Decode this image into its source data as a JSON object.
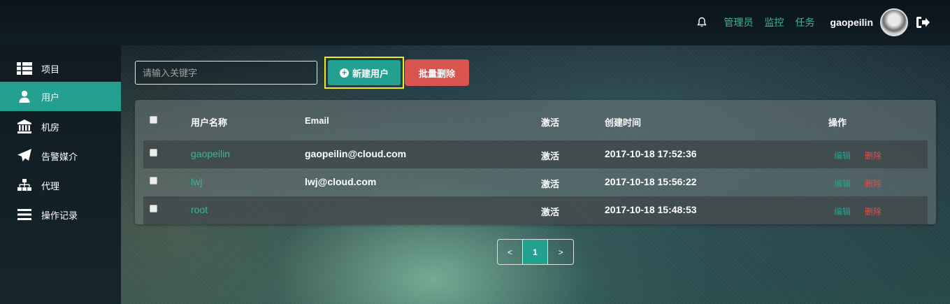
{
  "header": {
    "links": [
      "管理员",
      "监控",
      "任务"
    ],
    "username": "gaopeilin"
  },
  "sidebar": {
    "items": [
      {
        "label": "项目",
        "icon": "list-icon"
      },
      {
        "label": "用户",
        "icon": "user-icon",
        "active": true
      },
      {
        "label": "机房",
        "icon": "bank-icon"
      },
      {
        "label": "告警媒介",
        "icon": "paper-plane-icon"
      },
      {
        "label": "代理",
        "icon": "sitemap-icon"
      },
      {
        "label": "操作记录",
        "icon": "bars-icon"
      }
    ]
  },
  "toolbar": {
    "search_placeholder": "请输入关键字",
    "new_user_label": "新建用户",
    "batch_delete_label": "批量删除"
  },
  "table": {
    "headers": {
      "name": "用户名称",
      "email": "Email",
      "active": "激活",
      "created": "创建时间",
      "actions": "操作"
    },
    "rows": [
      {
        "name": "gaopeilin",
        "email": "gaopeilin@cloud.com",
        "active": "激活",
        "created": "2017-10-18 17:52:36",
        "edit": "编辑",
        "delete": "删除"
      },
      {
        "name": "lwj",
        "email": "lwj@cloud.com",
        "active": "激活",
        "created": "2017-10-18 15:56:22",
        "edit": "编辑",
        "delete": "删除"
      },
      {
        "name": "root",
        "email": "",
        "active": "激活",
        "created": "2017-10-18 15:48:53",
        "edit": "编辑",
        "delete": "删除"
      }
    ]
  },
  "pagination": {
    "prev": "<",
    "current": "1",
    "next": ">"
  },
  "colors": {
    "accent": "#23a08f",
    "danger": "#d9534f",
    "highlight": "#f1ea1c"
  }
}
